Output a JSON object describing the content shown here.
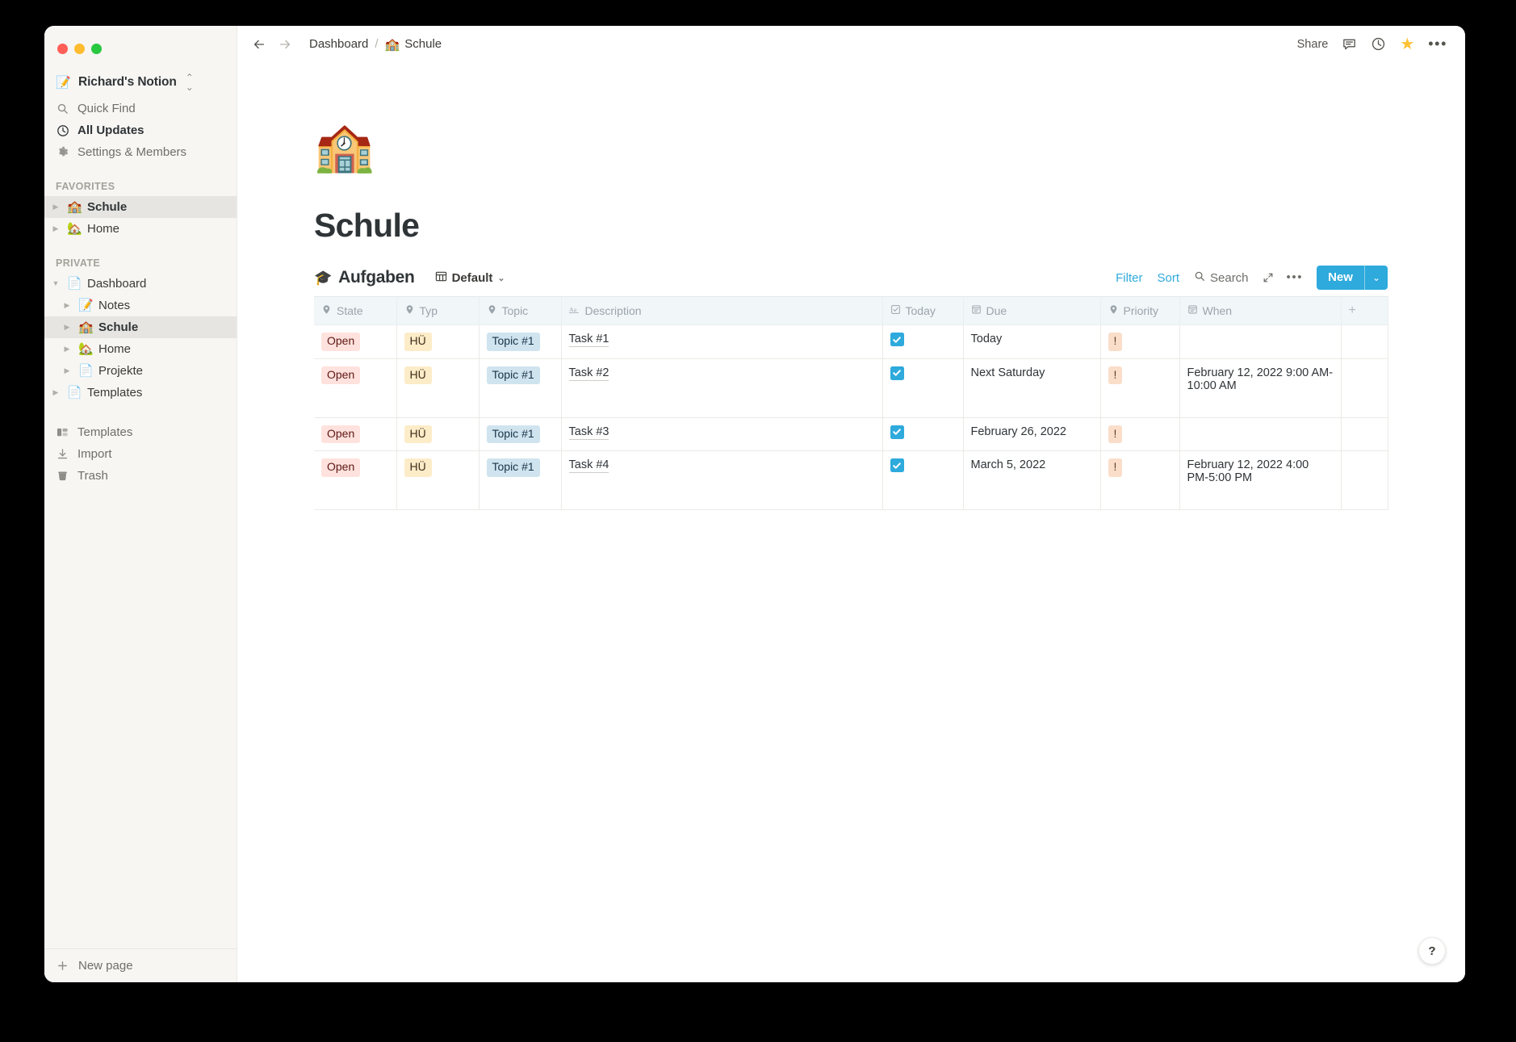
{
  "window": {
    "traffic_lights": [
      "close",
      "minimize",
      "zoom"
    ],
    "colors": {
      "close": "#ff5f57",
      "minimize": "#febc2e",
      "zoom": "#28c840",
      "accent": "#2eaadc",
      "star": "#ffc233",
      "sidebar_bg": "#f7f6f3"
    }
  },
  "sidebar": {
    "workspace": {
      "icon": "📝",
      "name": "Richard's Notion"
    },
    "nav": [
      {
        "icon": "search-icon",
        "label": "Quick Find",
        "strong": false
      },
      {
        "icon": "clock-icon",
        "label": "All Updates",
        "strong": true
      },
      {
        "icon": "gear-icon",
        "label": "Settings & Members",
        "strong": false
      }
    ],
    "sections": [
      {
        "label": "Favorites",
        "items": [
          {
            "emoji": "🏫",
            "label": "Schule",
            "indent": 1,
            "selected": true
          },
          {
            "emoji": "🏡",
            "label": "Home",
            "indent": 1,
            "selected": false
          }
        ]
      },
      {
        "label": "Private",
        "items": [
          {
            "emoji": "📄",
            "label": "Dashboard",
            "indent": 1,
            "selected": false,
            "expanded": true
          },
          {
            "emoji": "📝",
            "label": "Notes",
            "indent": 2,
            "selected": false
          },
          {
            "emoji": "🏫",
            "label": "Schule",
            "indent": 2,
            "selected": true
          },
          {
            "emoji": "🏡",
            "label": "Home",
            "indent": 2,
            "selected": false
          },
          {
            "emoji": "📄",
            "label": "Projekte",
            "indent": 2,
            "selected": false
          },
          {
            "emoji": "📄",
            "label": "Templates",
            "indent": 1,
            "selected": false
          }
        ]
      }
    ],
    "lower": [
      {
        "icon": "templates-icon",
        "label": "Templates"
      },
      {
        "icon": "import-icon",
        "label": "Import"
      },
      {
        "icon": "trash-icon",
        "label": "Trash"
      }
    ],
    "footer": {
      "icon": "plus-icon",
      "label": "New page"
    }
  },
  "topbar": {
    "back_icon": "arrow-left-icon",
    "forward_icon": "arrow-right-icon",
    "breadcrumb": [
      {
        "label": "Dashboard",
        "emoji": ""
      },
      {
        "label": "Schule",
        "emoji": "🏫"
      }
    ],
    "separator": "/",
    "share_label": "Share",
    "comment_icon": "comment-icon",
    "history_icon": "clock-icon",
    "favorite_icon": "star-icon",
    "more_icon": "more-horizontal-icon"
  },
  "page": {
    "icon": "🏫",
    "title": "Schule"
  },
  "database": {
    "icon": "🎓",
    "title": "Aufgaben",
    "view": {
      "icon": "table-icon",
      "label": "Default",
      "caret": "⌄"
    },
    "actions": {
      "filter": "Filter",
      "sort": "Sort",
      "search": "Search",
      "search_icon": "search-icon",
      "expand_icon": "expand-icon",
      "more_icon": "more-horizontal-icon",
      "new_label": "New",
      "new_caret": "⌄"
    },
    "columns": [
      {
        "label": "State",
        "icon": "select-icon"
      },
      {
        "label": "Typ",
        "icon": "select-icon"
      },
      {
        "label": "Topic",
        "icon": "select-icon"
      },
      {
        "label": "Description",
        "icon": "text-icon"
      },
      {
        "label": "Today",
        "icon": "checkbox-icon"
      },
      {
        "label": "Due",
        "icon": "date-icon"
      },
      {
        "label": "Priority",
        "icon": "select-icon"
      },
      {
        "label": "When",
        "icon": "date-icon"
      },
      {
        "label": "+",
        "icon": "add-property-icon"
      }
    ],
    "rows": [
      {
        "state": "Open",
        "typ": "HÜ",
        "topic": "Topic #1",
        "description": "Task #1",
        "today": true,
        "due": "Today",
        "priority": "!",
        "when": ""
      },
      {
        "state": "Open",
        "typ": "HÜ",
        "topic": "Topic #1",
        "description": "Task #2",
        "today": true,
        "due": "Next Saturday",
        "priority": "!",
        "when": "February 12, 2022 9:00 AM-10:00 AM"
      },
      {
        "state": "Open",
        "typ": "HÜ",
        "topic": "Topic #1",
        "description": "Task #3",
        "today": true,
        "due": "February 26, 2022",
        "priority": "!",
        "when": ""
      },
      {
        "state": "Open",
        "typ": "HÜ",
        "topic": "Topic #1",
        "description": "Task #4",
        "today": true,
        "due": "March 5, 2022",
        "priority": "!",
        "when": "February 12, 2022 4:00 PM-5:00 PM"
      }
    ]
  },
  "help": {
    "label": "?"
  }
}
